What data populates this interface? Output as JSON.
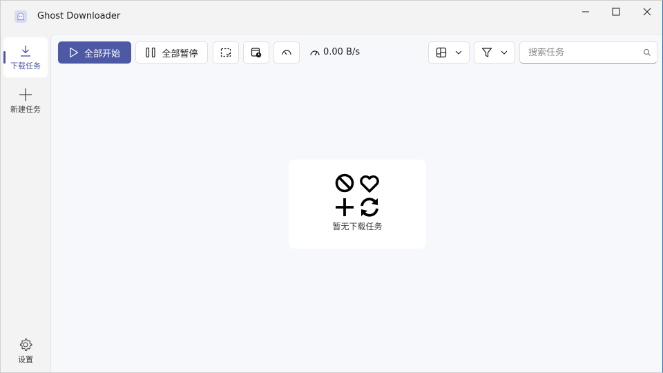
{
  "app": {
    "title": "Ghost Downloader",
    "icon": "ghost-logo-icon"
  },
  "window_controls": {
    "minimize_icon": "minimize-icon",
    "maximize_icon": "maximize-icon",
    "close_icon": "close-icon"
  },
  "sidebar": {
    "items": [
      {
        "label": "下载任务",
        "icon": "download-icon",
        "active": true
      },
      {
        "label": "新建任务",
        "icon": "plus-icon",
        "active": false
      }
    ],
    "settings": {
      "label": "设置",
      "icon": "gear-icon"
    }
  },
  "toolbar": {
    "start_all_label": "全部开始",
    "pause_all_label": "全部暂停",
    "speed": "0.00 B/s",
    "search_placeholder": "搜索任务",
    "accent_color": "#4d59a5"
  },
  "empty_state": {
    "text": "暂无下载任务",
    "icons": [
      "prohibited-icon",
      "heart-icon",
      "plus-icon",
      "refresh-icon"
    ]
  }
}
